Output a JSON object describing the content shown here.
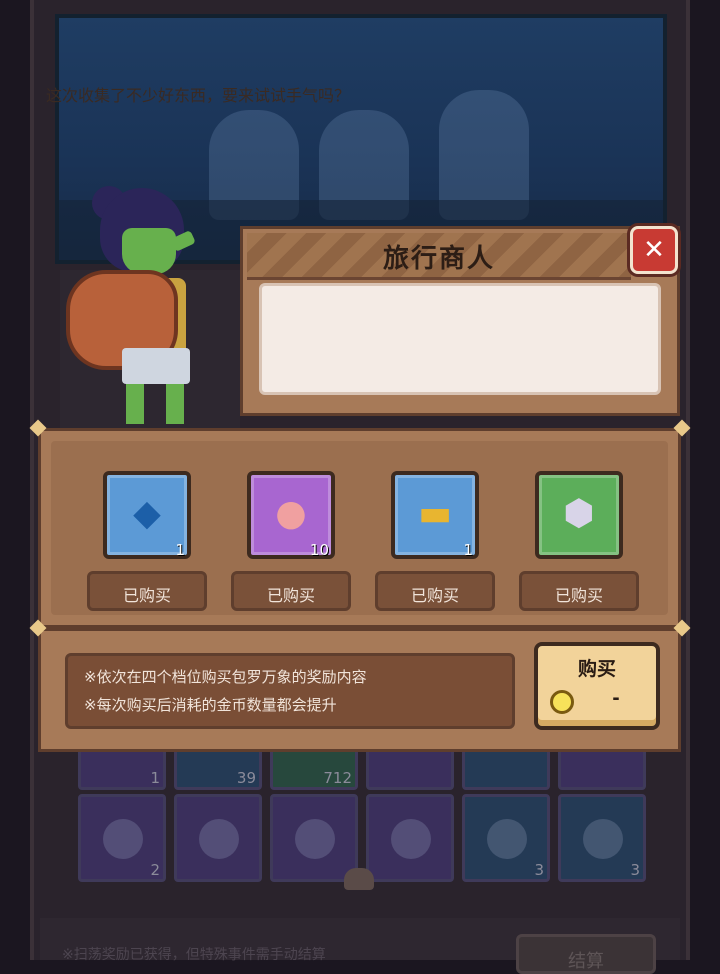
{
  "dialog": {
    "title": "旅行商人",
    "message": "这次收集了不少好东西，要来试试手气吗？",
    "close_icon": "close-x-icon"
  },
  "shop": {
    "items": [
      {
        "icon": "blue-crystal-icon",
        "rarity_color": "#5c9ad6",
        "count": "1",
        "status": "已购买"
      },
      {
        "icon": "raw-meat-icon",
        "rarity_color": "#a866d0",
        "count": "10",
        "status": "已购买"
      },
      {
        "icon": "gold-bar-icon",
        "rarity_color": "#5c9ad6",
        "count": "1",
        "status": "已购买"
      },
      {
        "icon": "shield-badge-icon",
        "rarity_color": "#5cae5a",
        "count": "",
        "status": "已购买"
      }
    ]
  },
  "info": {
    "line1": "※依次在四个档位购买包罗万象的奖励内容",
    "line2": "※每次购买后消耗的金币数量都会提升"
  },
  "buy_button": {
    "label": "购买",
    "price": "-",
    "currency_icon": "gold-coin-icon"
  },
  "background_grid": {
    "row1_counts": [
      "1",
      "39",
      "712",
      "",
      "",
      ""
    ],
    "row2_counts": [
      "2",
      "",
      "",
      "",
      "3",
      "3"
    ]
  },
  "bottom_bar": {
    "notice": "※扫荡奖励已获得，但特殊事件需手动结算",
    "settle_label": "结算"
  }
}
